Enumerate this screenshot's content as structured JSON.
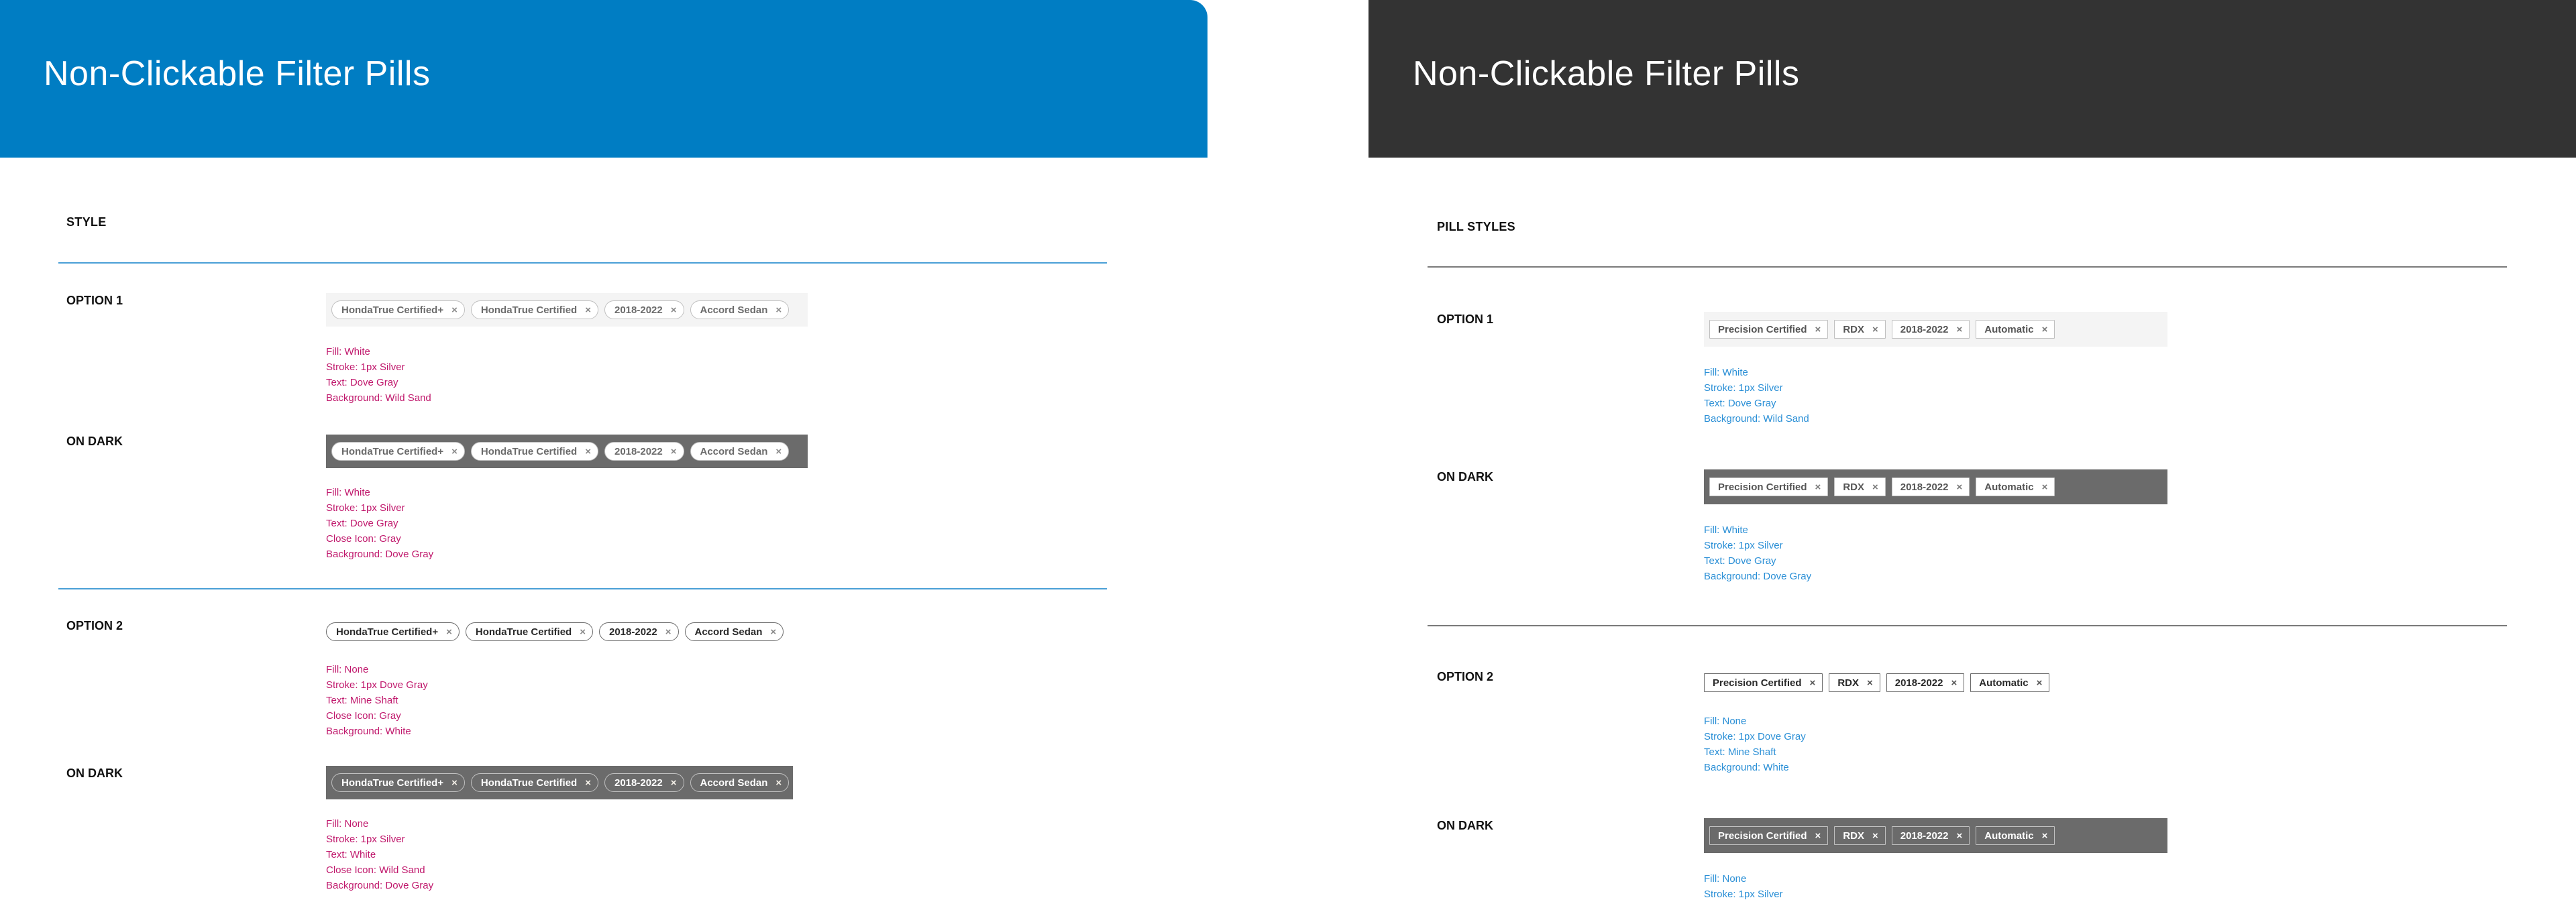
{
  "colors": {
    "left_header": "#007dc3",
    "right_header": "#333333",
    "wild_sand": "#f4f4f4",
    "dove_gray": "#6b6b6b",
    "silver": "#c0c0c0",
    "note_left": "#c0186c",
    "note_right": "#2a8fd6"
  },
  "left": {
    "title": "Non-Clickable Filter Pills",
    "section": "STYLE",
    "close_symbol": "×",
    "pills": [
      "HondaTrue Certified+",
      "HondaTrue Certified",
      "2018-2022",
      "Accord Sedan"
    ],
    "opt1": {
      "label": "OPTION 1",
      "notes": [
        "Fill: White",
        "Stroke: 1px Silver",
        "Text: Dove Gray",
        "Background: Wild Sand"
      ]
    },
    "opt1_dark": {
      "label": "ON DARK",
      "notes": [
        "Fill: White",
        "Stroke: 1px Silver",
        "Text: Dove Gray",
        "Close Icon: Gray",
        "Background: Dove Gray"
      ]
    },
    "opt2": {
      "label": "OPTION 2",
      "notes": [
        "Fill: None",
        "Stroke: 1px Dove Gray",
        "Text: Mine Shaft",
        "Close Icon: Gray",
        "Background: White"
      ]
    },
    "opt2_dark": {
      "label": "ON DARK",
      "notes": [
        "Fill: None",
        "Stroke: 1px Silver",
        "Text: White",
        "Close Icon: Wild Sand",
        "Background: Dove Gray"
      ]
    }
  },
  "right": {
    "title": "Non-Clickable Filter Pills",
    "section": "PILL STYLES",
    "close_symbol": "×",
    "pills": [
      "Precision Certified",
      "RDX",
      "2018-2022",
      "Automatic"
    ],
    "opt1": {
      "label": "OPTION 1",
      "notes": [
        "Fill: White",
        "Stroke: 1px Silver",
        "Text: Dove Gray",
        "Background: Wild Sand"
      ]
    },
    "opt1_dark": {
      "label": "ON DARK",
      "notes": [
        "Fill: White",
        "Stroke: 1px Silver",
        "Text: Dove Gray",
        "Background: Dove Gray"
      ]
    },
    "opt2": {
      "label": "OPTION 2",
      "notes": [
        "Fill: None",
        "Stroke: 1px Dove Gray",
        "Text: Mine Shaft",
        "Background: White"
      ]
    },
    "opt2_dark": {
      "label": "ON DARK",
      "notes": [
        "Fill: None",
        "Stroke: 1px Silver"
      ]
    }
  }
}
